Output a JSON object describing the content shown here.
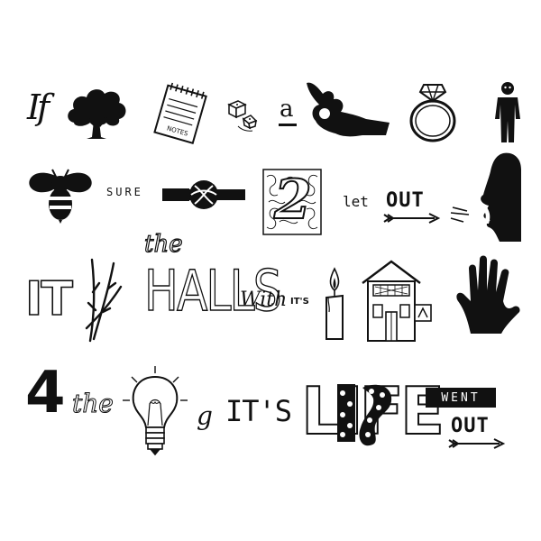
{
  "title": "",
  "colors": {
    "ink": "#111111",
    "paper": "#ffffff"
  },
  "rows": [
    {
      "tokens": [
        {
          "kind": "text",
          "name": "word-if",
          "text": "If"
        },
        {
          "kind": "icon",
          "name": "tree-icon"
        },
        {
          "kind": "icon",
          "name": "notepad-icon",
          "text": "NOTES"
        },
        {
          "kind": "icon",
          "name": "dice-icon"
        },
        {
          "kind": "text",
          "name": "word-a",
          "text": "a"
        },
        {
          "kind": "icon",
          "name": "okay-hand-icon"
        },
        {
          "kind": "icon",
          "name": "ring-icon"
        },
        {
          "kind": "icon",
          "name": "man-icon"
        }
      ]
    },
    {
      "tokens": [
        {
          "kind": "icon",
          "name": "bee-icon"
        },
        {
          "kind": "text",
          "name": "word-sure",
          "text": "SURE"
        },
        {
          "kind": "icon",
          "name": "knot-icon"
        },
        {
          "kind": "text",
          "name": "number-2",
          "text": "2"
        },
        {
          "kind": "text",
          "name": "word-let",
          "text": "let"
        },
        {
          "kind": "text",
          "name": "word-out-1",
          "text": "OUT"
        },
        {
          "kind": "icon",
          "name": "arrow-icon"
        },
        {
          "kind": "icon",
          "name": "shouting-face-icon"
        }
      ]
    },
    {
      "tokens": [
        {
          "kind": "text",
          "name": "word-it-block",
          "text": "IT"
        },
        {
          "kind": "icon",
          "name": "twigs-icon"
        },
        {
          "kind": "text",
          "name": "word-the-1",
          "text": "the"
        },
        {
          "kind": "text",
          "name": "word-halls",
          "text": "HALLS"
        },
        {
          "kind": "text",
          "name": "word-with",
          "text": "With"
        },
        {
          "kind": "text",
          "name": "word-its-1",
          "text": "IT'S"
        },
        {
          "kind": "icon",
          "name": "candle-icon"
        },
        {
          "kind": "icon",
          "name": "house-icon"
        },
        {
          "kind": "icon",
          "name": "hand-icon"
        }
      ]
    },
    {
      "tokens": [
        {
          "kind": "text",
          "name": "number-4",
          "text": "4"
        },
        {
          "kind": "text",
          "name": "word-the-2",
          "text": "the"
        },
        {
          "kind": "icon",
          "name": "light-bulb-icon"
        },
        {
          "kind": "text",
          "name": "letter-g",
          "text": "g"
        },
        {
          "kind": "text",
          "name": "word-its-2",
          "text": "IT'S"
        },
        {
          "kind": "text",
          "name": "word-life",
          "text": "LIFE"
        },
        {
          "kind": "text",
          "name": "word-went",
          "text": "WENT"
        },
        {
          "kind": "text",
          "name": "word-out-2",
          "text": "OUT"
        },
        {
          "kind": "icon",
          "name": "arrow-icon"
        }
      ]
    }
  ]
}
